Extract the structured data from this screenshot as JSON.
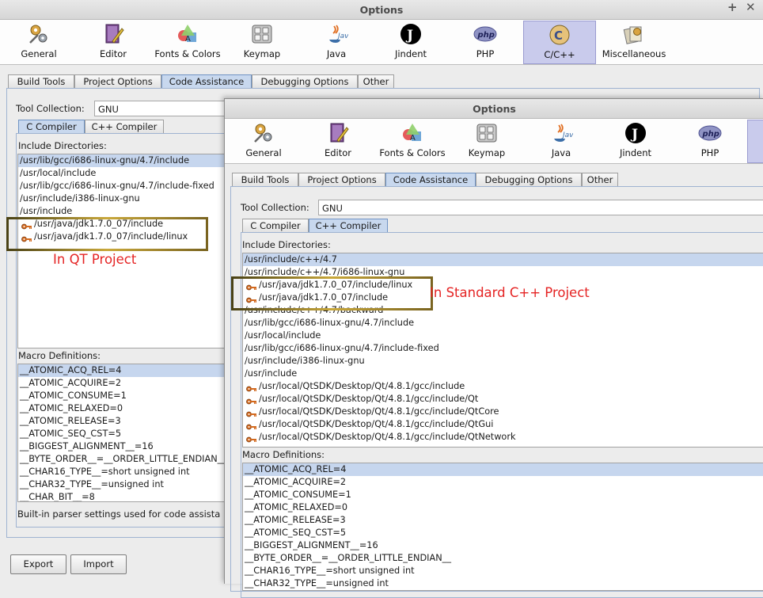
{
  "colors": {
    "accent": "#c6d6ee",
    "annotation": "#e52424",
    "highlight": "#9a8427"
  },
  "windows": [
    {
      "title": "Options",
      "title_buttons": [
        "+",
        "✕"
      ],
      "categories": [
        {
          "label": "General",
          "icon": "gears-icon"
        },
        {
          "label": "Editor",
          "icon": "book-pen-icon"
        },
        {
          "label": "Fonts & Colors",
          "icon": "color-shapes-icon"
        },
        {
          "label": "Keymap",
          "icon": "keyboard-icon"
        },
        {
          "label": "Java",
          "icon": "java-icon"
        },
        {
          "label": "Jindent",
          "icon": "jindent-icon"
        },
        {
          "label": "PHP",
          "icon": "php-icon"
        },
        {
          "label": "C/C++",
          "icon": "cpp-icon",
          "selected": true
        },
        {
          "label": "Miscellaneous",
          "icon": "misc-icon"
        }
      ],
      "tabs": [
        "Build Tools",
        "Project Options",
        "Code Assistance",
        "Debugging Options",
        "Other"
      ],
      "active_tab": "Code Assistance",
      "tool_collection_label": "Tool Collection:",
      "tool_collection_value": "GNU",
      "compiler_tabs": [
        "C Compiler",
        "C++ Compiler"
      ],
      "active_compiler_tab": "C Compiler",
      "include_label": "Include Directories:",
      "include_dirs": [
        {
          "text": "/usr/lib/gcc/i686-linux-gnu/4.7/include",
          "selected": true
        },
        {
          "text": "/usr/local/include"
        },
        {
          "text": "/usr/lib/gcc/i686-linux-gnu/4.7/include-fixed"
        },
        {
          "text": "/usr/include/i386-linux-gnu"
        },
        {
          "text": "/usr/include"
        },
        {
          "text": "/usr/java/jdk1.7.0_07/include",
          "user": true
        },
        {
          "text": "/usr/java/jdk1.7.0_07/include/linux",
          "user": true
        }
      ],
      "annotation": "In QT Project",
      "macro_label": "Macro Definitions:",
      "macros": [
        "__ATOMIC_ACQ_REL=4",
        "__ATOMIC_ACQUIRE=2",
        "__ATOMIC_CONSUME=1",
        "__ATOMIC_RELAXED=0",
        "__ATOMIC_RELEASE=3",
        "__ATOMIC_SEQ_CST=5",
        "__BIGGEST_ALIGNMENT__=16",
        "__BYTE_ORDER__=__ORDER_LITTLE_ENDIAN__",
        "__CHAR16_TYPE__=short unsigned int",
        "__CHAR32_TYPE__=unsigned int",
        "__CHAR_BIT__=8"
      ],
      "status_text": "Built-in parser settings used for code assista",
      "export_label": "Export",
      "import_label": "Import"
    },
    {
      "title": "Options",
      "categories": [
        {
          "label": "General",
          "icon": "gears-icon"
        },
        {
          "label": "Editor",
          "icon": "book-pen-icon"
        },
        {
          "label": "Fonts & Colors",
          "icon": "color-shapes-icon"
        },
        {
          "label": "Keymap",
          "icon": "keyboard-icon"
        },
        {
          "label": "Java",
          "icon": "java-icon"
        },
        {
          "label": "Jindent",
          "icon": "jindent-icon"
        },
        {
          "label": "PHP",
          "icon": "php-icon"
        }
      ],
      "tabs": [
        "Build Tools",
        "Project Options",
        "Code Assistance",
        "Debugging Options",
        "Other"
      ],
      "active_tab": "Code Assistance",
      "tool_collection_label": "Tool Collection:",
      "tool_collection_value": "GNU",
      "compiler_tabs": [
        "C Compiler",
        "C++ Compiler"
      ],
      "active_compiler_tab": "C++ Compiler",
      "include_label": "Include Directories:",
      "include_dirs": [
        {
          "text": "/usr/include/c++/4.7",
          "selected": true
        },
        {
          "text": "/usr/include/c++/4.7/i686-linux-gnu"
        },
        {
          "text": "/usr/java/jdk1.7.0_07/include/linux",
          "user": true
        },
        {
          "text": "/usr/java/jdk1.7.0_07/include",
          "user": true
        },
        {
          "text": "/usr/include/c++/4.7/backward"
        },
        {
          "text": "/usr/lib/gcc/i686-linux-gnu/4.7/include"
        },
        {
          "text": "/usr/local/include"
        },
        {
          "text": "/usr/lib/gcc/i686-linux-gnu/4.7/include-fixed"
        },
        {
          "text": "/usr/include/i386-linux-gnu"
        },
        {
          "text": "/usr/include"
        },
        {
          "text": "/usr/local/QtSDK/Desktop/Qt/4.8.1/gcc/include",
          "user": true
        },
        {
          "text": "/usr/local/QtSDK/Desktop/Qt/4.8.1/gcc/include/Qt",
          "user": true
        },
        {
          "text": "/usr/local/QtSDK/Desktop/Qt/4.8.1/gcc/include/QtCore",
          "user": true
        },
        {
          "text": "/usr/local/QtSDK/Desktop/Qt/4.8.1/gcc/include/QtGui",
          "user": true
        },
        {
          "text": "/usr/local/QtSDK/Desktop/Qt/4.8.1/gcc/include/QtNetwork",
          "user": true
        }
      ],
      "annotation": "In Standard C++ Project",
      "macro_label": "Macro Definitions:",
      "macros": [
        "__ATOMIC_ACQ_REL=4",
        "__ATOMIC_ACQUIRE=2",
        "__ATOMIC_CONSUME=1",
        "__ATOMIC_RELAXED=0",
        "__ATOMIC_RELEASE=3",
        "__ATOMIC_SEQ_CST=5",
        "__BIGGEST_ALIGNMENT__=16",
        "__BYTE_ORDER__=__ORDER_LITTLE_ENDIAN__",
        "__CHAR16_TYPE__=short unsigned int",
        "__CHAR32_TYPE__=unsigned int"
      ]
    }
  ]
}
